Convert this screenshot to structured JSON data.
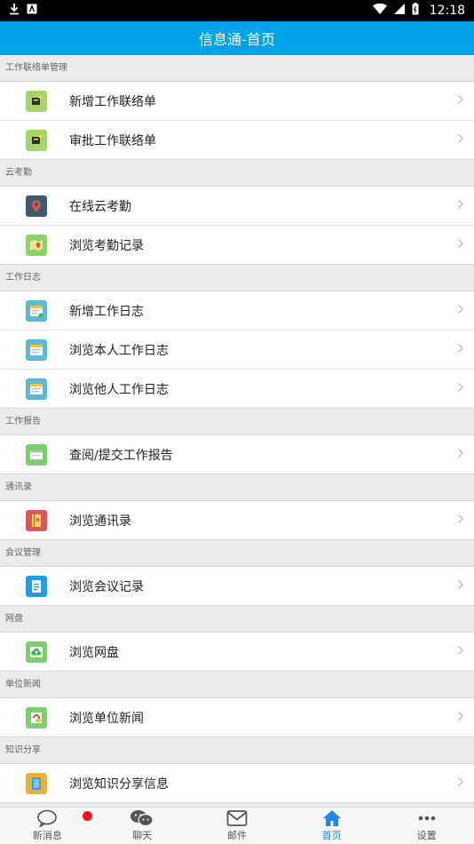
{
  "status_bar": {
    "time": "12:18"
  },
  "app_bar": {
    "title": "信息通-首页"
  },
  "sections": [
    {
      "title": "工作联络单管理",
      "items": [
        {
          "label": "新增工作联络单",
          "icon": "new-contact-form-icon",
          "color": "#a8d56b"
        },
        {
          "label": "审批工作联络单",
          "icon": "approve-contact-form-icon",
          "color": "#a8d56b"
        }
      ]
    },
    {
      "title": "云考勤",
      "items": [
        {
          "label": "在线云考勤",
          "icon": "location-pin-icon",
          "color": "#3c5a72"
        },
        {
          "label": "浏览考勤记录",
          "icon": "map-icon",
          "color": "#8dd36a"
        }
      ]
    },
    {
      "title": "工作日志",
      "items": [
        {
          "label": "新增工作日志",
          "icon": "calendar-add-icon",
          "color": "#5cb9d8"
        },
        {
          "label": "浏览本人工作日志",
          "icon": "calendar-icon",
          "color": "#5cb9d8"
        },
        {
          "label": "浏览他人工作日志",
          "icon": "calendar-icon",
          "color": "#5cb9d8"
        }
      ]
    },
    {
      "title": "工作报告",
      "items": [
        {
          "label": "查阅/提交工作报告",
          "icon": "report-icon",
          "color": "#7ccf6e"
        }
      ]
    },
    {
      "title": "通讯录",
      "items": [
        {
          "label": "浏览通讯录",
          "icon": "address-book-icon",
          "color": "#d9585a"
        }
      ]
    },
    {
      "title": "会议管理",
      "items": [
        {
          "label": "浏览会议记录",
          "icon": "meeting-notes-icon",
          "color": "#1f9ee3"
        }
      ]
    },
    {
      "title": "网盘",
      "items": [
        {
          "label": "浏览网盘",
          "icon": "cloud-disk-icon",
          "color": "#7ccf6e"
        }
      ]
    },
    {
      "title": "单位新闻",
      "items": [
        {
          "label": "浏览单位新闻",
          "icon": "news-icon",
          "color": "#7ccf6e"
        }
      ]
    },
    {
      "title": "知识分享",
      "items": [
        {
          "label": "浏览知识分享信息",
          "icon": "book-icon",
          "color": "#e8b13c"
        }
      ]
    }
  ],
  "tab_bar": [
    {
      "label": "新消息",
      "icon": "chat-bubble-icon"
    },
    {
      "label": "聊天",
      "icon": "wechat-icon"
    },
    {
      "label": "邮件",
      "icon": "mail-icon"
    },
    {
      "label": "首页",
      "icon": "home-icon",
      "active": true
    },
    {
      "label": "设置",
      "icon": "more-dots-icon"
    }
  ]
}
